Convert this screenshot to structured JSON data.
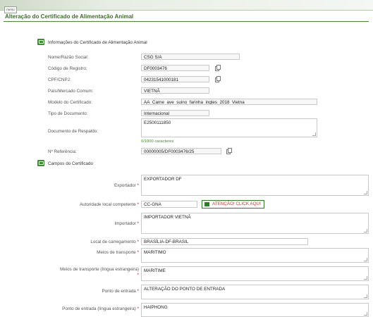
{
  "header": {
    "menu_label": "menu"
  },
  "page_title": "Alteração do Certificado de Alimentação Animal",
  "section_info": {
    "title": "Informações do Certificado de Alimentação Animal",
    "fields": {
      "razao_social": {
        "label": "Nome/Razão Social:",
        "value": "CSG S/A"
      },
      "codigo_registro": {
        "label": "Código de Registro:",
        "value": "DF0003476"
      },
      "cpf_cnpj": {
        "label": "CPF/CNPJ:",
        "value": "04231541000181"
      },
      "pais": {
        "label": "País/Mercado Comum:",
        "value": "VIETNÃ"
      },
      "modelo": {
        "label": "Modelo do Certificado:",
        "value": "AA_Carne_ave_suino_farinha_ingles_2018_Vietna"
      },
      "tipo_documento": {
        "label": "Tipo de Documento:",
        "value": "Internacional"
      },
      "documento_respaldo": {
        "label": "Documento de Respaldo:",
        "value": "E2500111850",
        "counter": "0/1000 caracteres"
      },
      "referencia": {
        "label": "Nº Referência:",
        "value": "00000005/DF0003476/25"
      }
    }
  },
  "section_campos": {
    "title": "Campos do Certificado",
    "required_mark": "*",
    "fields": {
      "exportador": {
        "label": "Exportador",
        "value": "EXPORTADOR DF"
      },
      "autoridade": {
        "label": "Autoridade local competente",
        "value": "CC-GNA",
        "button": "ATENÇÃO! CLICK AQUI"
      },
      "importador": {
        "label": "Importador",
        "value": "IMPORTADOR VIETNÃ"
      },
      "local_carregamento": {
        "label": "Local de carregamento",
        "value": "BRASÍLIA-DF-BRASIL"
      },
      "meios_transporte": {
        "label": "Meios de transporte",
        "value": "MARITIMO"
      },
      "meios_transporte_estrangeira": {
        "label": "Meios de transporte (língua estrangeira)",
        "value": "MARITIME"
      },
      "ponto_entrada": {
        "label": "Ponto de entrada",
        "value": "ALTERAÇÃO DO PONTO DE ENTRADA"
      },
      "ponto_entrada_estrangeira": {
        "label": "Ponto de entrada (língua estrangeira)",
        "value": "HAIPHONG"
      }
    }
  },
  "icons": [
    "menu-icon",
    "section-icon",
    "copy-icon",
    "warning-icon"
  ],
  "colors": {
    "accent": "#3d6b30",
    "section_icon": "#3f8a35",
    "warning_text": "#c0392b",
    "required": "#dd0000"
  }
}
